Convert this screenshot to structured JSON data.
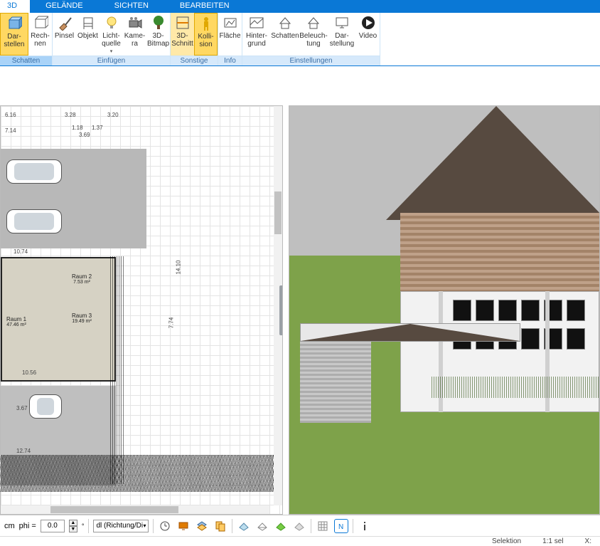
{
  "tabs": {
    "t0": "3D",
    "t1": "GELÄNDE",
    "t2": "SICHTEN",
    "t3": "BEARBEITEN"
  },
  "ribbon": {
    "g_schatten": "Schatten",
    "g_einfuegen": "Einfügen",
    "g_sonstige": "Sonstige",
    "g_info": "Info",
    "g_einstellungen": "Einstellungen",
    "darstellen": "Dar-\nstellen",
    "rechnen": "Rech-\nnen",
    "pinsel": "Pinsel",
    "objekt": "Objekt",
    "lichtquelle": "Licht-\nquelle",
    "kamera": "Kame-\nra",
    "bitmap3d": "3D-\nBitmap",
    "schnitt3d": "3D-\nSchnitt",
    "kollision": "Kolli-\nsion",
    "flaeche": "Fläche",
    "hintergrund": "Hinter-\ngrund",
    "schatten_btn": "Schatten",
    "beleuchtung": "Beleuch-\ntung",
    "darstellung": "Dar-\nstellung",
    "video": "Video"
  },
  "plan": {
    "dim_a": "6.16",
    "dim_b": "3.28",
    "dim_c": "3.20",
    "dim_d": "7.14",
    "dim_e": "1.18",
    "dim_f": "1.37",
    "dim_g": "3.69",
    "dim_w": "10.74",
    "dim_h": "7.74",
    "dim_s": "14.10",
    "room1": "Raum 1",
    "room1_sub": "47.46 m²",
    "room2": "Raum 2",
    "room2_sub": "7.53 m²",
    "room3": "Raum 3",
    "room3_sub": "19.49 m²",
    "dim_k": "3.67",
    "dim_l": "10.56",
    "dim_m": "12.74"
  },
  "bottom": {
    "cm": "cm",
    "phi": "phi =",
    "phi_val": "0.0",
    "dl": "dl (Richtung/Di",
    "selektion": "Selektion",
    "ratio": "1:1 sel",
    "coord": "X:"
  }
}
